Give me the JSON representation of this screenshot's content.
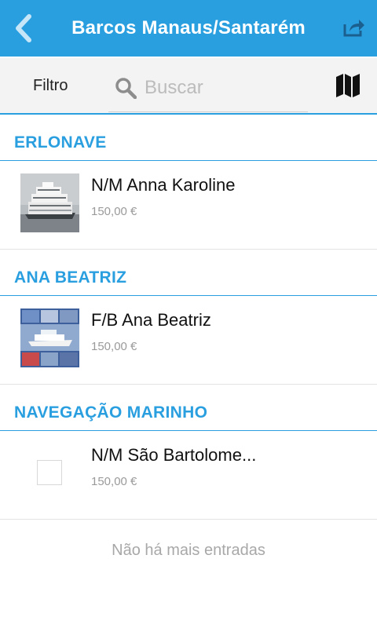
{
  "header": {
    "title": "Barcos Manaus/Santarém"
  },
  "toolbar": {
    "filter_label": "Filtro",
    "search_placeholder": "Buscar"
  },
  "sections": [
    {
      "title": "ERLONAVE",
      "items": [
        {
          "name": "N/M Anna Karoline",
          "price": "150,00 €",
          "thumb": "boat-photo"
        }
      ]
    },
    {
      "title": "ANA BEATRIZ",
      "items": [
        {
          "name": "F/B Ana Beatriz",
          "price": "150,00 €",
          "thumb": "boat-collage-photo"
        }
      ]
    },
    {
      "title": "NAVEGAÇÃO MARINHO",
      "items": [
        {
          "name": "N/M São Bartolome...",
          "price": "150,00 €",
          "thumb": "image-placeholder"
        }
      ]
    }
  ],
  "footer": {
    "text": "Não há mais entradas"
  },
  "colors": {
    "accent": "#2a9fe0",
    "muted_text": "#9a9a9a"
  },
  "icons": [
    "back-chevron-icon",
    "share-icon",
    "search-icon",
    "map-icon"
  ]
}
